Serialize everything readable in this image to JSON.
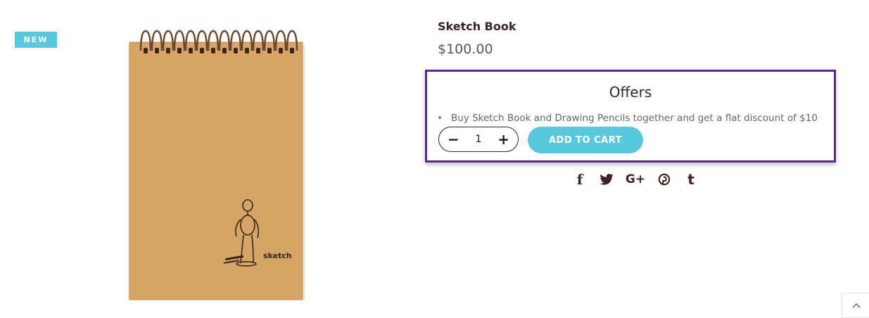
{
  "badge": {
    "label": "NEW"
  },
  "product": {
    "title": "Sketch Book",
    "price": "$100.00",
    "image_label": "sketch"
  },
  "offers": {
    "heading": "Offers",
    "items": [
      "Buy Sketch Book and Drawing Pencils together and get a flat discount of $10"
    ]
  },
  "cart": {
    "minus": "−",
    "quantity": "1",
    "plus": "+",
    "add_label": "ADD TO CART"
  },
  "share": {
    "facebook": "f",
    "twitter": "twitter-icon",
    "google_plus": "G+",
    "pinterest": "pinterest-icon",
    "tumblr": "t"
  },
  "colors": {
    "accent": "#5ac8dc",
    "highlight_border": "#5b2a8a",
    "text": "#3a2426"
  }
}
